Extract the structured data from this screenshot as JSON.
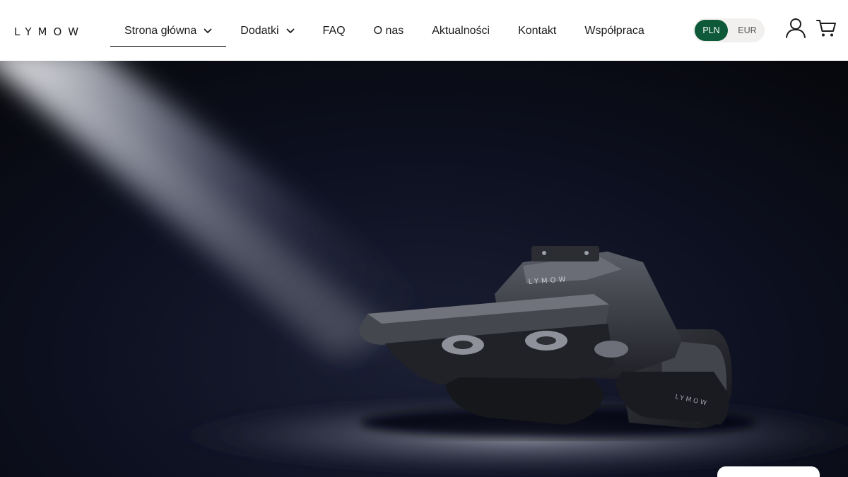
{
  "brand": {
    "logo_text": "LYMOW"
  },
  "nav": {
    "items": [
      {
        "label": "Strona główna",
        "has_dropdown": true,
        "active": true
      },
      {
        "label": "Dodatki",
        "has_dropdown": true,
        "active": false
      },
      {
        "label": "FAQ",
        "has_dropdown": false,
        "active": false
      },
      {
        "label": "O nas",
        "has_dropdown": false,
        "active": false
      },
      {
        "label": "Aktualności",
        "has_dropdown": false,
        "active": false
      },
      {
        "label": "Kontakt",
        "has_dropdown": false,
        "active": false
      },
      {
        "label": "Współpraca",
        "has_dropdown": false,
        "active": false
      }
    ]
  },
  "currency": {
    "selected": "PLN",
    "other": "EUR",
    "accent": "#0e5a38"
  },
  "icons": {
    "account": "user-icon",
    "cart": "cart-icon"
  },
  "hero": {
    "product_badge": "LYMOW",
    "side_badge": "LYMOW"
  }
}
